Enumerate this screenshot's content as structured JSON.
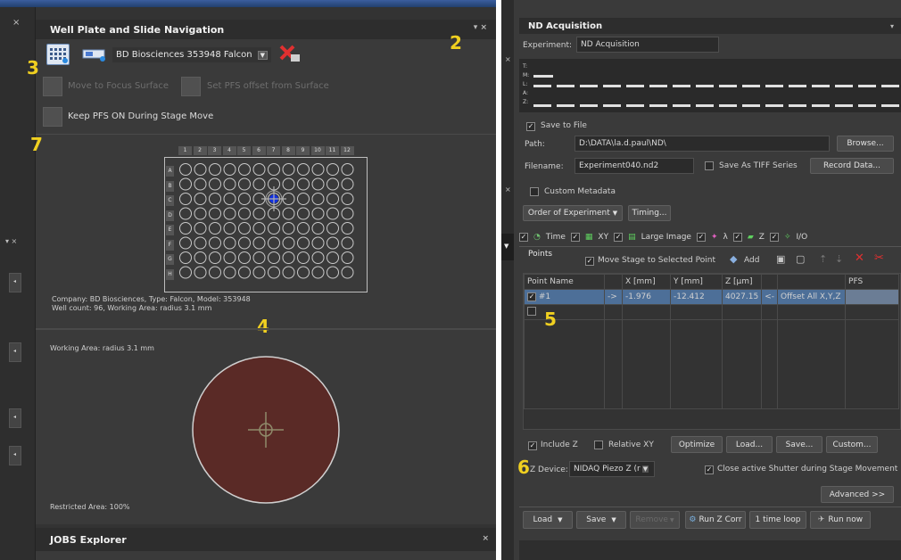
{
  "left": {
    "title": "Well Plate and Slide Navigation",
    "plate_selector": "BD Biosciences 353948 Falcon",
    "move_to_focus": "Move to Focus Surface",
    "set_pfs_offset": "Set PFS offset from Surface",
    "keep_pfs": "Keep PFS ON During Stage Move",
    "col_labels": [
      "1",
      "2",
      "3",
      "4",
      "5",
      "6",
      "7",
      "8",
      "9",
      "10",
      "11",
      "12"
    ],
    "row_labels": [
      "A",
      "B",
      "C",
      "D",
      "E",
      "F",
      "G",
      "H"
    ],
    "company_info_1": "Company: BD Biosciences, Type: Falcon, Model: 353948",
    "company_info_2": "Well count: 96, Working Area: radius 3.1 mm",
    "working_area": "Working Area: radius 3.1 mm",
    "restricted_area": "Restricted Area: 100%",
    "jobs_explorer": "JOBS Explorer"
  },
  "right": {
    "title": "ND Acquisition",
    "experiment_label": "Experiment:",
    "experiment_value": "ND Acquisition",
    "track_labels": [
      "T:",
      "M:",
      "L:",
      "A:",
      "Z:"
    ],
    "save_to_file": "Save to File",
    "path_label": "Path:",
    "path_value": "D:\\DATA\\la.d.paul\\ND\\",
    "browse": "Browse...",
    "filename_label": "Filename:",
    "filename_value": "Experiment040.nd2",
    "save_tiff": "Save As TIFF Series",
    "record_data": "Record Data...",
    "custom_metadata": "Custom Metadata",
    "order_of_experiment": "Order of Experiment",
    "timing": "Timing...",
    "dim_tabs": [
      "Time",
      "XY",
      "Large Image",
      "λ",
      "Z",
      "I/O"
    ],
    "points_tab": "Points",
    "move_stage": "Move Stage to Selected Point",
    "add": "Add",
    "table_headers": [
      "Point Name",
      "",
      "X [mm]",
      "Y [mm]",
      "Z [µm]",
      "",
      "",
      "PFS"
    ],
    "row1": {
      "name": "#1",
      "arrow": "->",
      "x": "-1.976",
      "y": "-12.412",
      "z": "4027.15",
      "back": "<-",
      "offset": "Offset All X,Y,Z",
      "pfs": ""
    },
    "include_z": "Include Z",
    "relative_xy": "Relative XY",
    "optimize": "Optimize",
    "load_dots": "Load...",
    "save_dots": "Save...",
    "custom_dots": "Custom...",
    "z_device_label": "Z Device:",
    "z_device_value": "NIDAQ Piezo Z (r",
    "close_shutter": "Close active Shutter during Stage Movement",
    "advanced": "Advanced >>",
    "load": "Load",
    "save": "Save",
    "remove": "Remove",
    "run_z_corr": "Run Z Corr",
    "one_time_loop": "1 time loop",
    "run_now": "Run now"
  },
  "annotations": {
    "n2": "2",
    "n3": "3",
    "n4": "4",
    "n5": "5",
    "n6": "6",
    "n7": "7"
  },
  "colors": {
    "accent_blue": "#1030e0",
    "well_area": "#5a2a26",
    "highlight": "#4d7fb0"
  }
}
